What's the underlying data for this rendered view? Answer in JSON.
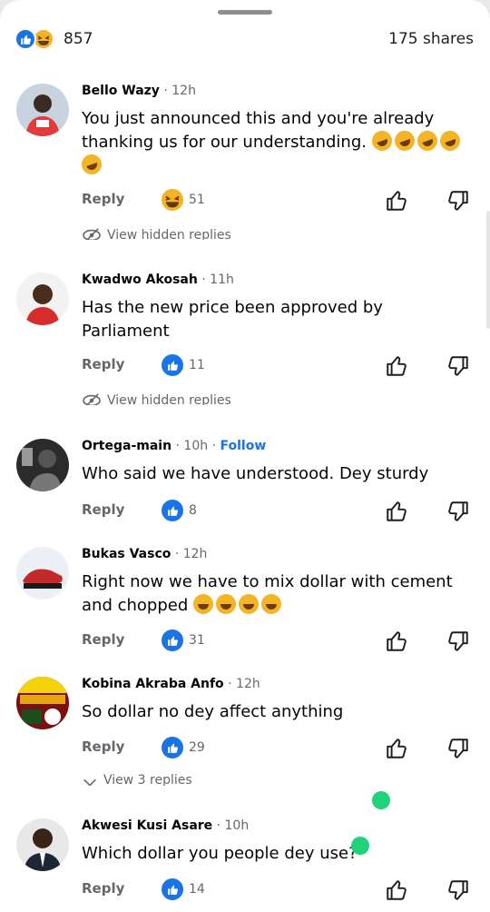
{
  "colors": {
    "brand_blue": "#1b74e4",
    "haha_yellow": "#f7b125",
    "meta_gray": "#65676b",
    "indicator_green": "#22d27a"
  },
  "reactions": {
    "count": "857",
    "shares": "175 shares",
    "icons": [
      "like-icon",
      "haha-icon"
    ]
  },
  "labels": {
    "reply": "Reply",
    "view_hidden": "View hidden replies",
    "view_3": "View 3 replies"
  },
  "comments": [
    {
      "name": "Bello Wazy",
      "time": "· 12h",
      "text": "You just announced this and you're already thanking us for our understanding.",
      "emojis": "rolling-on-floor-laughing x5",
      "reaction_icon": "haha-icon",
      "reaction_count": "51"
    },
    {
      "name": "Kwadwo Akosah",
      "time": "· 11h",
      "text": "Has the new price been approved by Parliament",
      "reaction_icon": "like-icon",
      "reaction_count": "11"
    },
    {
      "name": "Ortega-main",
      "time": "· 10h ·",
      "follow": "Follow",
      "text": "Who said we have understood. Dey sturdy",
      "reaction_icon": "like-icon",
      "reaction_count": "8"
    },
    {
      "name": "Bukas Vasco",
      "time": "· 12h",
      "text": "Right now we have to mix dollar with cement and chopped",
      "emojis": "grinning-face x4",
      "reaction_icon": "like-icon",
      "reaction_count": "31"
    },
    {
      "name": "Kobina Akraba Anfo",
      "time": "· 12h",
      "text": "So dollar no dey affect anything",
      "reaction_icon": "like-icon",
      "reaction_count": "29"
    },
    {
      "name": "Akwesi Kusi Asare",
      "time": "· 10h",
      "text": "Which dollar you people dey use?",
      "reaction_icon": "like-icon",
      "reaction_count": "14"
    }
  ]
}
